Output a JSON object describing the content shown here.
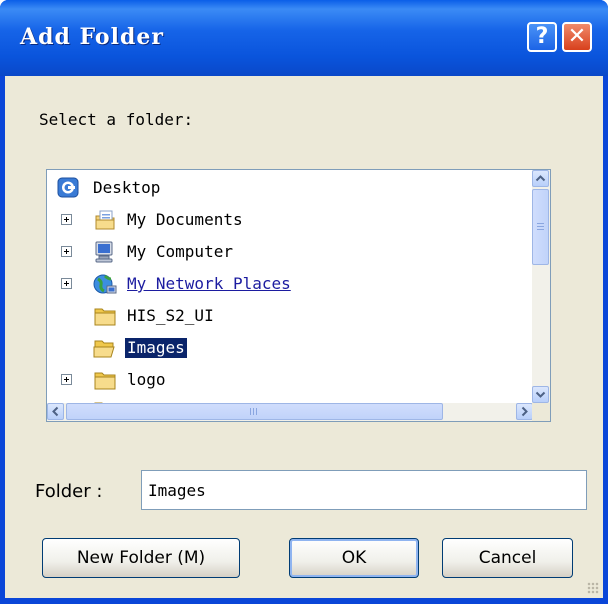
{
  "window": {
    "title": "Add Folder",
    "help_glyph": "?",
    "close_glyph": "✕"
  },
  "prompt": "Select a folder:",
  "tree": {
    "items": [
      {
        "label": "Desktop",
        "icon": "desktop-icon",
        "expandable": false,
        "state": "normal"
      },
      {
        "label": "My Documents",
        "icon": "my-documents-icon",
        "expandable": true,
        "state": "normal"
      },
      {
        "label": "My Computer",
        "icon": "my-computer-icon",
        "expandable": true,
        "state": "normal"
      },
      {
        "label": "My Network Places",
        "icon": "network-places-icon",
        "expandable": true,
        "state": "hover"
      },
      {
        "label": "HIS_S2_UI",
        "icon": "folder-icon",
        "expandable": false,
        "state": "normal"
      },
      {
        "label": "Images",
        "icon": "folder-open-icon",
        "expandable": false,
        "state": "selected"
      },
      {
        "label": "logo",
        "icon": "folder-icon",
        "expandable": true,
        "state": "normal"
      }
    ]
  },
  "folder_field": {
    "label": "Folder :",
    "value": "Images"
  },
  "buttons": {
    "new_folder": "New Folder (M)",
    "ok": "OK",
    "cancel": "Cancel"
  },
  "colors": {
    "title_bar": "#0a54dc",
    "dialog_bg": "#ece9d8",
    "selection": "#0a246a",
    "link": "#1c1ca0"
  }
}
